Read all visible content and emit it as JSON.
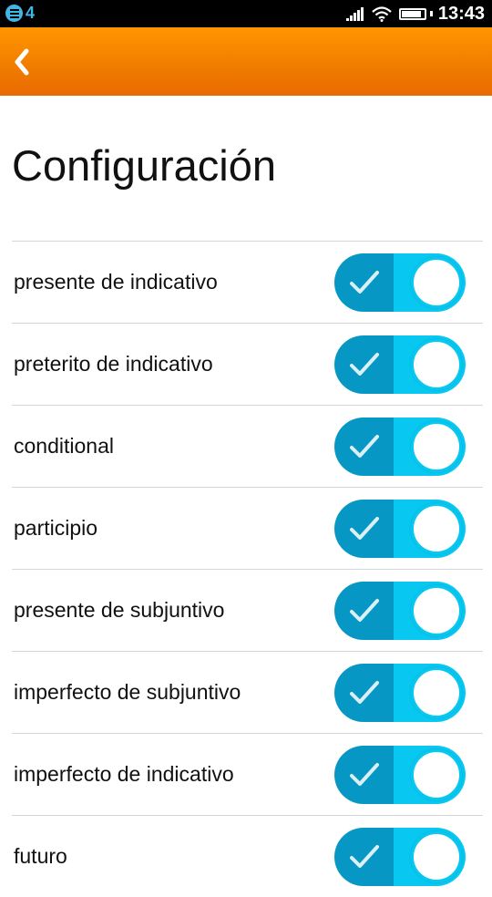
{
  "status_bar": {
    "notification_count": "4",
    "time": "13:43",
    "icons": [
      "app-notification-icon",
      "signal-icon",
      "wifi-icon",
      "battery-icon"
    ]
  },
  "header": {
    "back_icon": "chevron-left-icon",
    "color_top": "#ff9600",
    "color_bottom": "#e86a00"
  },
  "page_title": "Configuración",
  "settings": [
    {
      "label": "presente de indicativo",
      "enabled": true
    },
    {
      "label": "preterito de indicativo",
      "enabled": true
    },
    {
      "label": "conditional",
      "enabled": true
    },
    {
      "label": "participio",
      "enabled": true
    },
    {
      "label": "presente de subjuntivo",
      "enabled": true
    },
    {
      "label": "imperfecto de subjuntivo",
      "enabled": true
    },
    {
      "label": "imperfecto de indicativo",
      "enabled": true
    },
    {
      "label": "futuro",
      "enabled": true
    }
  ],
  "toggle_colors": {
    "track_dark": "#0797c4",
    "track_light": "#08c7f0",
    "knob": "#ffffff"
  }
}
